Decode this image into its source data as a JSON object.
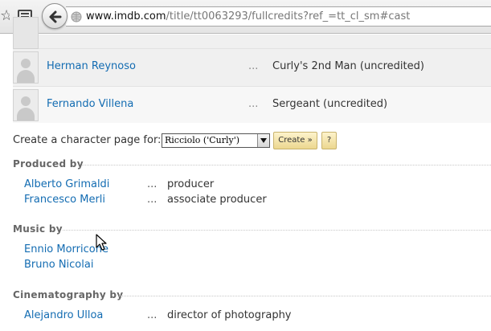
{
  "browser": {
    "url_domain": "www.imdb.com",
    "url_path": "/title/tt0063293/fullcredits?ref_=tt_cl_sm#cast"
  },
  "cast": [
    {
      "name": "Herman Reynoso",
      "ellipsis": "...",
      "character": "Curly's 2nd Man (uncredited)"
    },
    {
      "name": "Fernando Villena",
      "ellipsis": "...",
      "character": "Sergeant (uncredited)"
    }
  ],
  "character_page": {
    "label": "Create a character page for:",
    "selected_option": "Ricciolo ('Curly')",
    "create_label": "Create »",
    "help_label": "?"
  },
  "produced_by": {
    "title": "Produced by",
    "rows": [
      {
        "name": "Alberto Grimaldi",
        "ellipsis": "...",
        "credit": "producer"
      },
      {
        "name": "Francesco Merli",
        "ellipsis": "...",
        "credit": "associate producer"
      }
    ]
  },
  "music_by": {
    "title": "Music by",
    "rows": [
      {
        "name": "Ennio Morricone"
      },
      {
        "name": "Bruno Nicolai"
      }
    ]
  },
  "cinematography_by": {
    "title": "Cinematography by",
    "rows": [
      {
        "name": "Alejandro Ulloa",
        "ellipsis": "...",
        "credit": "director of photography"
      }
    ]
  },
  "colors": {
    "link": "#136cb2",
    "row_odd": "#f0f0f0",
    "row_even": "#f7f7f7",
    "button": "#f2e2a8"
  }
}
